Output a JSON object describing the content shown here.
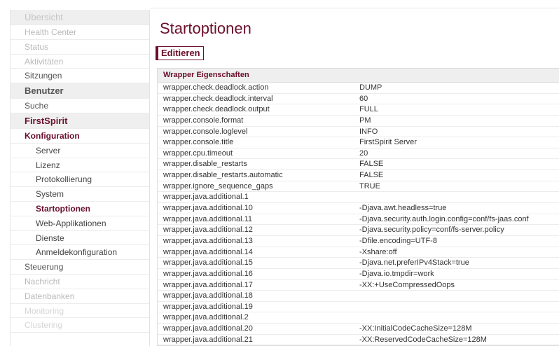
{
  "sidebar": {
    "items": [
      {
        "label": "Übersicht",
        "kind": "header-faded"
      },
      {
        "label": "Health Center",
        "kind": "faded"
      },
      {
        "label": "Status",
        "kind": "faded"
      },
      {
        "label": "Aktivitäten",
        "kind": "faded"
      },
      {
        "label": "Sitzungen",
        "kind": "plain"
      },
      {
        "label": "Benutzer",
        "kind": "header"
      },
      {
        "label": "Suche",
        "kind": "plain"
      },
      {
        "label": "FirstSpirit",
        "kind": "header-section"
      },
      {
        "label": "Konfiguration",
        "kind": "section"
      },
      {
        "label": "Server",
        "kind": "sub"
      },
      {
        "label": "Lizenz",
        "kind": "sub"
      },
      {
        "label": "Protokollierung",
        "kind": "sub"
      },
      {
        "label": "System",
        "kind": "sub"
      },
      {
        "label": "Startoptionen",
        "kind": "sub-active"
      },
      {
        "label": "Web-Applikationen",
        "kind": "sub"
      },
      {
        "label": "Dienste",
        "kind": "sub"
      },
      {
        "label": "Anmeldekonfiguration",
        "kind": "sub"
      },
      {
        "label": "Steuerung",
        "kind": "plain-faded"
      },
      {
        "label": "Nachricht",
        "kind": "faded"
      },
      {
        "label": "Datenbanken",
        "kind": "faded"
      },
      {
        "label": "Monitoring",
        "kind": "faded2"
      },
      {
        "label": "Clustering",
        "kind": "faded2"
      }
    ]
  },
  "main": {
    "title": "Startoptionen",
    "edit_label": "Editieren",
    "table_title": "Wrapper Eigenschaften",
    "rows": [
      [
        "wrapper.check.deadlock.action",
        "DUMP"
      ],
      [
        "wrapper.check.deadlock.interval",
        "60"
      ],
      [
        "wrapper.check.deadlock.output",
        "FULL"
      ],
      [
        "wrapper.console.format",
        "PM"
      ],
      [
        "wrapper.console.loglevel",
        "INFO"
      ],
      [
        "wrapper.console.title",
        "FirstSpirit Server"
      ],
      [
        "wrapper.cpu.timeout",
        "20"
      ],
      [
        "wrapper.disable_restarts",
        "FALSE"
      ],
      [
        "wrapper.disable_restarts.automatic",
        "FALSE"
      ],
      [
        "wrapper.ignore_sequence_gaps",
        "TRUE"
      ],
      [
        "wrapper.java.additional.1",
        ""
      ],
      [
        "wrapper.java.additional.10",
        "-Djava.awt.headless=true"
      ],
      [
        "wrapper.java.additional.11",
        "-Djava.security.auth.login.config=conf/fs-jaas.conf"
      ],
      [
        "wrapper.java.additional.12",
        "-Djava.security.policy=conf/fs-server.policy"
      ],
      [
        "wrapper.java.additional.13",
        "-Dfile.encoding=UTF-8"
      ],
      [
        "wrapper.java.additional.14",
        "-Xshare:off"
      ],
      [
        "wrapper.java.additional.15",
        "-Djava.net.preferIPv4Stack=true"
      ],
      [
        "wrapper.java.additional.16",
        "-Djava.io.tmpdir=work"
      ],
      [
        "wrapper.java.additional.17",
        "-XX:+UseCompressedOops"
      ],
      [
        "wrapper.java.additional.18",
        ""
      ],
      [
        "wrapper.java.additional.19",
        ""
      ],
      [
        "wrapper.java.additional.2",
        ""
      ],
      [
        "wrapper.java.additional.20",
        "-XX:InitialCodeCacheSize=128M"
      ],
      [
        "wrapper.java.additional.21",
        "-XX:ReservedCodeCacheSize=128M"
      ]
    ]
  },
  "colors": {
    "accent": "#6b0f2b",
    "header_bg": "#efefef",
    "faded_text": "#b9b9b9"
  }
}
